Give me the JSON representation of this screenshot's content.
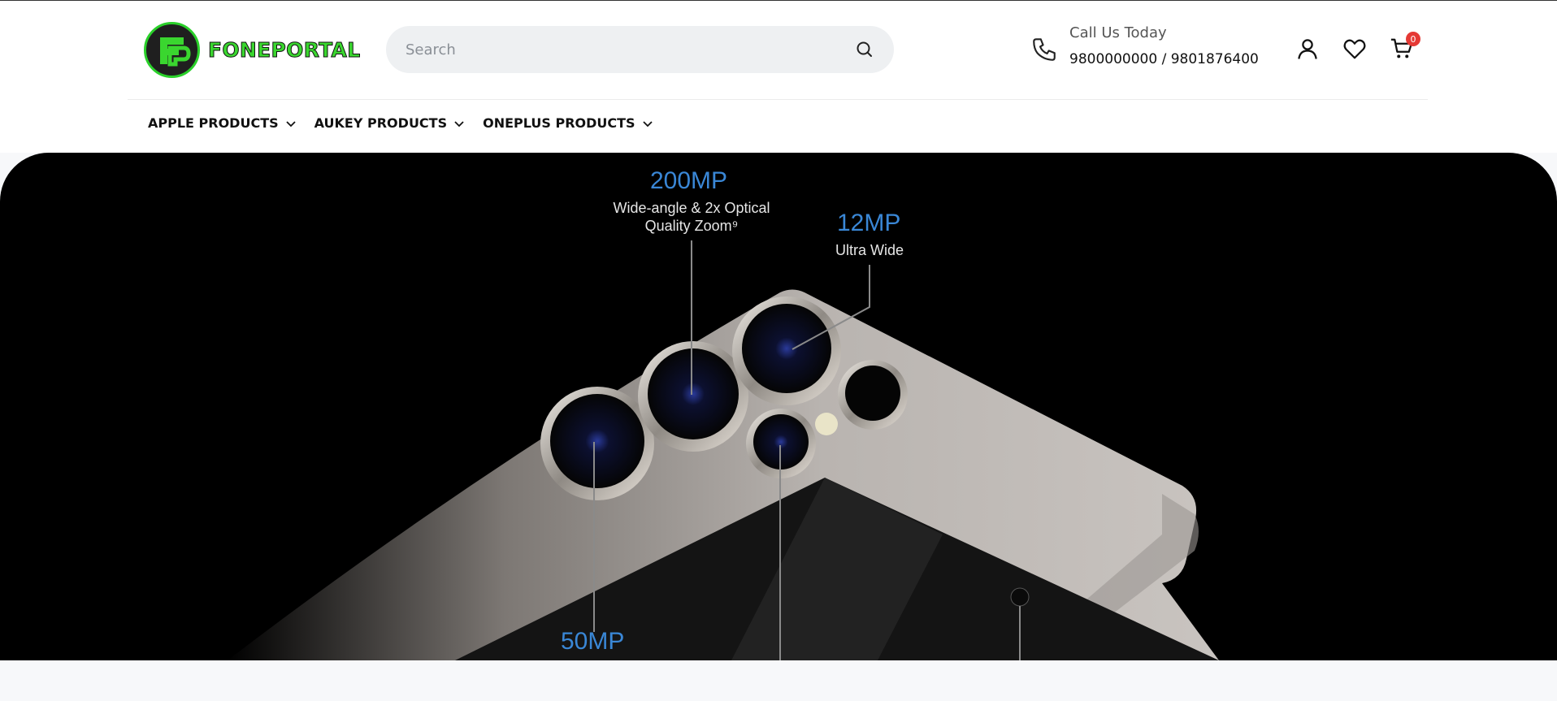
{
  "brand": {
    "name": "FONEPORTAL"
  },
  "search": {
    "placeholder": "Search"
  },
  "contact": {
    "label": "Call Us Today",
    "numbers": "9800000000 / 9801876400"
  },
  "cart": {
    "count": "0"
  },
  "nav": [
    {
      "label": "APPLE PRODUCTS"
    },
    {
      "label": "AUKEY PRODUCTS"
    },
    {
      "label": "ONEPLUS PRODUCTS"
    }
  ],
  "hero": {
    "cam1_mp": "200MP",
    "cam1_desc1": "Wide-angle & 2x Optical",
    "cam1_desc2": "Quality Zoom⁹",
    "cam2_mp": "12MP",
    "cam2_desc": "Ultra Wide",
    "cam3_mp": "50MP"
  },
  "colors": {
    "accent": "#3ad62f",
    "badge": "#e53935",
    "hero_bg": "#000000",
    "mp_label": "#3a87d6"
  }
}
